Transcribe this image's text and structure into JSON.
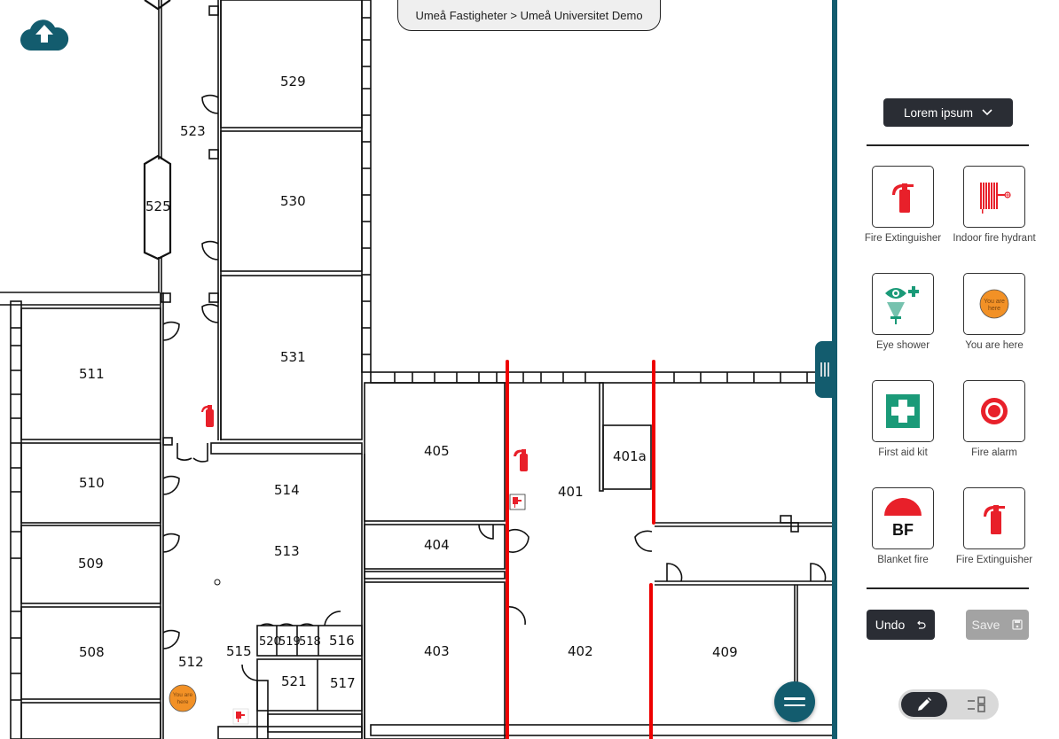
{
  "breadcrumb": {
    "text": "Umeå Fastigheter > Umeå Universitet Demo",
    "items": [
      "Umeå Fastigheter",
      "Umeå Universitet Demo"
    ],
    "separator": ">"
  },
  "toolbar": {
    "upload_icon": "cloud-upload-icon",
    "menu_icon": "hamburger-menu-icon",
    "resize_handle_icon": "grip-vertical-icon"
  },
  "colors": {
    "brand": "#135c6e",
    "dark": "#2a2d34",
    "fire_red": "#e8202a",
    "safety_green": "#1a9a78",
    "you_are_here_orange": "#f29126",
    "disabled_gray": "#a3a3a3"
  },
  "map": {
    "rooms": [
      "529",
      "523",
      "530",
      "525",
      "531",
      "511",
      "510",
      "509",
      "508",
      "514",
      "513",
      "512",
      "515",
      "520",
      "519",
      "518",
      "516",
      "521",
      "517",
      "405",
      "404",
      "403",
      "401",
      "401a",
      "402",
      "409"
    ],
    "markers": [
      {
        "type": "fire-extinguisher",
        "room": "511 corridor"
      },
      {
        "type": "fire-extinguisher",
        "room": "401"
      },
      {
        "type": "indoor-fire-hydrant",
        "room": "401"
      },
      {
        "type": "you-are-here",
        "room": "512",
        "label": "You are here"
      },
      {
        "type": "indoor-fire-hydrant",
        "room": "515"
      }
    ],
    "you_are_here_text": "You are here"
  },
  "panel": {
    "category_select": {
      "value": "Lorem ipsum",
      "icon": "chevron-down-icon"
    },
    "symbols": [
      {
        "label": "Fire Extinguisher",
        "icon": "fire-extinguisher-icon"
      },
      {
        "label": "Indoor fire hydrant",
        "icon": "fire-hose-reel-icon"
      },
      {
        "label": "Eye shower",
        "icon": "eye-shower-icon"
      },
      {
        "label": "You are here",
        "icon": "you-are-here-icon",
        "badge_text": "You are here"
      },
      {
        "label": "First aid kit",
        "icon": "first-aid-icon"
      },
      {
        "label": "Fire alarm",
        "icon": "fire-alarm-icon"
      },
      {
        "label": "Blanket fire",
        "icon": "fire-blanket-icon",
        "badge_text": "BF"
      },
      {
        "label": "Fire Extinguisher",
        "icon": "fire-extinguisher-icon"
      }
    ],
    "undo": {
      "label": "Undo",
      "icon": "undo-icon"
    },
    "save": {
      "label": "Save",
      "icon": "floppy-disk-icon",
      "disabled": true
    },
    "mode_toggle": {
      "active": "edit",
      "options": [
        {
          "id": "edit",
          "icon": "pencil-icon"
        },
        {
          "id": "list",
          "icon": "list-view-icon"
        }
      ]
    }
  }
}
